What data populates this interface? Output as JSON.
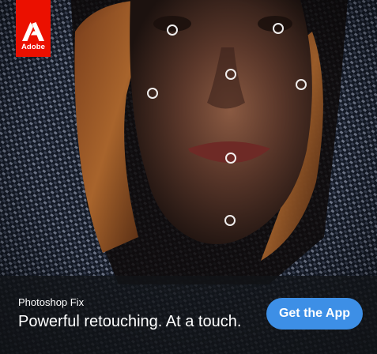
{
  "brand": {
    "logo_text": "Adobe",
    "logo_color": "#eb1000"
  },
  "retouch_markers": {
    "icon": "circle-outline-icon",
    "count": 7
  },
  "footer": {
    "app_name": "Photoshop Fix",
    "tagline": "Powerful retouching. At a touch.",
    "cta_label": "Get the App",
    "cta_color": "#3d8fe6"
  }
}
